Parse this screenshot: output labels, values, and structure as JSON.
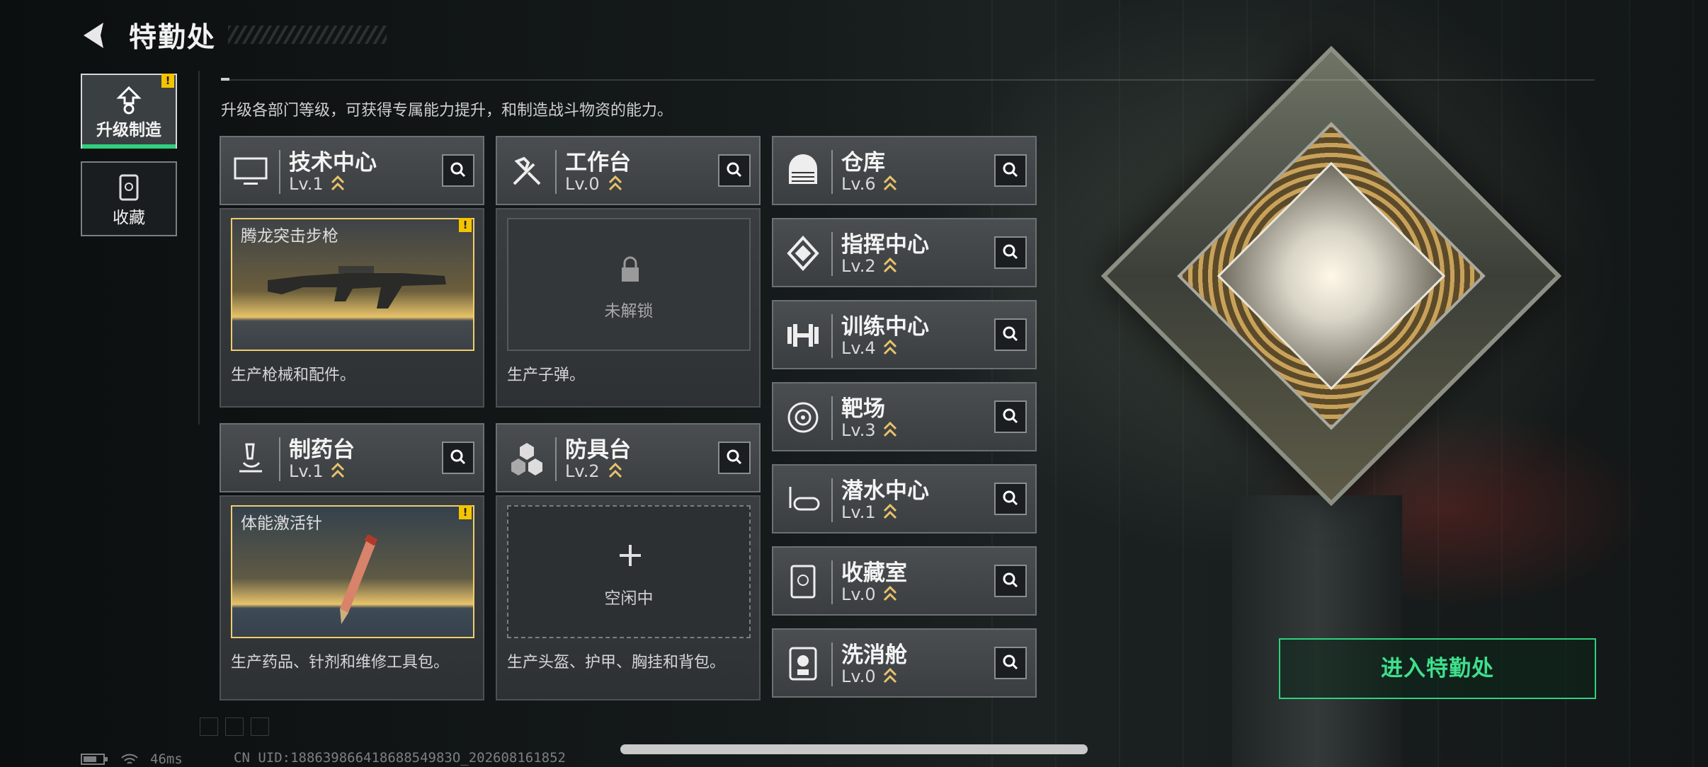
{
  "header": {
    "title": "特勤处",
    "subtitle": "升级各部门等级，可获得专属能力提升，和制造战斗物资的能力。"
  },
  "nav": {
    "tabs": [
      {
        "label": "升级制造",
        "active": true,
        "warning": "!"
      },
      {
        "label": "收藏",
        "active": false
      }
    ]
  },
  "stations": {
    "tech_center": {
      "name": "技术中心",
      "level": "Lv.1",
      "item_name": "腾龙突击步枪",
      "warning": "!",
      "desc": "生产枪械和配件。"
    },
    "workbench": {
      "name": "工作台",
      "level": "Lv.0",
      "slot_status": "未解锁",
      "desc": "生产子弹。"
    },
    "pharmacy": {
      "name": "制药台",
      "level": "Lv.1",
      "item_name": "体能激活针",
      "warning": "!",
      "desc": "生产药品、针剂和维修工具包。"
    },
    "armor_bench": {
      "name": "防具台",
      "level": "Lv.2",
      "slot_status": "空闲中",
      "desc": "生产头盔、护甲、胸挂和背包。"
    }
  },
  "facilities": [
    {
      "name": "仓库",
      "level": "Lv.6",
      "icon": "warehouse-icon"
    },
    {
      "name": "指挥中心",
      "level": "Lv.2",
      "icon": "command-center-icon"
    },
    {
      "name": "训练中心",
      "level": "Lv.4",
      "icon": "dumbbell-icon"
    },
    {
      "name": "靶场",
      "level": "Lv.3",
      "icon": "target-icon"
    },
    {
      "name": "潜水中心",
      "level": "Lv.1",
      "icon": "diving-mask-icon"
    },
    {
      "name": "收藏室",
      "level": "Lv.0",
      "icon": "collection-room-icon"
    },
    {
      "name": "洗消舱",
      "level": "Lv.0",
      "icon": "hazmat-icon"
    }
  ],
  "enter_button": "进入特勤处",
  "status": {
    "ping": "46ms",
    "uid": "CN UID:18863986641868854983O_202608161852"
  },
  "colors": {
    "accent_green": "#2fd17e",
    "warning_yellow": "#f5c400",
    "gold": "#f0cd6a"
  }
}
